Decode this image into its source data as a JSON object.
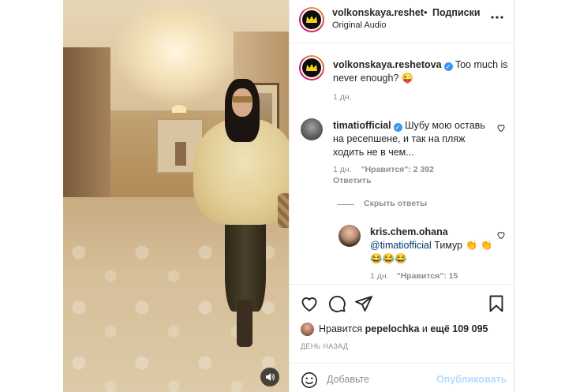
{
  "header": {
    "username": "volkonskaya.reshetova",
    "follow_label": "Подписки",
    "separator": "•",
    "audio_label": "Original Audio"
  },
  "caption": {
    "username": "volkonskaya.reshetova",
    "text": " Too much is never enough? 😜",
    "time": "1 дн."
  },
  "comments": [
    {
      "username": "timatiofficial",
      "text": " Шубу мою оставь на ресепшене, и так на пляж ходить не в чем...",
      "time": "1 дн.",
      "likes": "\"Нравится\": 2 392",
      "reply_label": "Ответить",
      "hide_replies_label": "Скрыть ответы"
    },
    {
      "username": "kris.chem.ohana",
      "mention": "@timatiofficial",
      "text": " Тимур 👏 👏😂😂😂",
      "time": "1 дн.",
      "likes": "\"Нравится\": 15"
    }
  ],
  "likes": {
    "prefix": "Нравится ",
    "first_user": "pepelochka",
    "middle": " и ",
    "count": "ещё 109 095"
  },
  "post_date": "ДЕНЬ НАЗАД",
  "add_comment": {
    "placeholder": "Добавьте",
    "publish_label": "Опубликовать"
  },
  "colors": {
    "text": "#262626",
    "secondary": "#8e8e8e",
    "verified": "#3897f0",
    "publish_disabled": "#b3dbff",
    "mention": "#00376b"
  },
  "icons": [
    "sound-icon",
    "more-icon",
    "verified-icon",
    "heart-icon",
    "comment-icon",
    "share-icon",
    "save-icon",
    "emoji-icon"
  ]
}
